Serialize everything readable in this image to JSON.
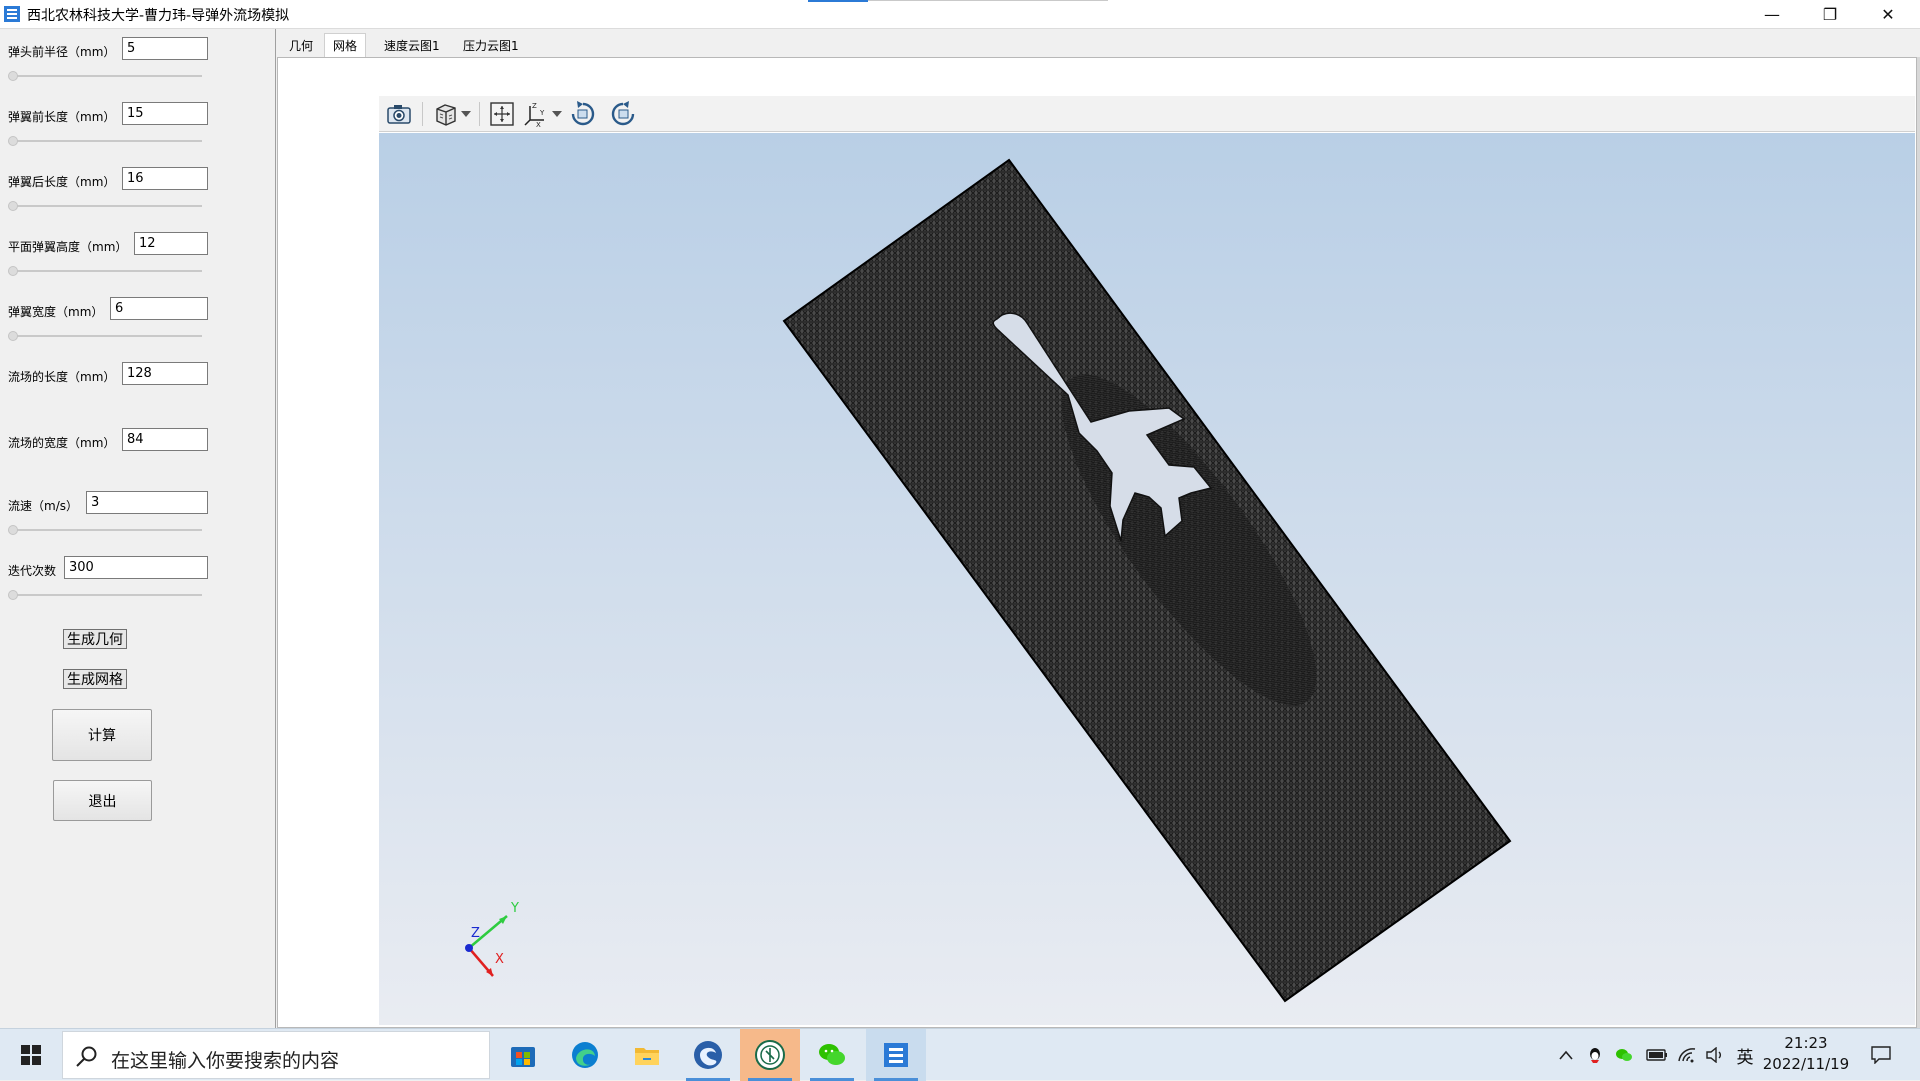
{
  "window": {
    "title": "西北农林科技大学-曹力玮-导弹外流场模拟",
    "minimize_glyph": "—",
    "restore_glyph": "❐",
    "close_glyph": "✕"
  },
  "params": [
    {
      "label": "弹头前半径（mm）",
      "value": "5"
    },
    {
      "label": "弹翼前长度（mm）",
      "value": "15"
    },
    {
      "label": "弹翼后长度（mm）",
      "value": "16"
    },
    {
      "label": "平面弹翼高度（mm）",
      "value": "12"
    },
    {
      "label": "弹翼宽度（mm）",
      "value": "6"
    },
    {
      "label": "流场的长度（mm）",
      "value": "128"
    },
    {
      "label": "流场的宽度（mm）",
      "value": "84"
    },
    {
      "label": "流速（m/s）",
      "value": "3"
    },
    {
      "label": "迭代次数",
      "value": "300"
    }
  ],
  "buttons": {
    "gen_geometry": "生成几何",
    "gen_mesh": "生成网格",
    "compute": "计算",
    "exit": "退出"
  },
  "tabs": [
    {
      "label": "几何"
    },
    {
      "label": "网格"
    },
    {
      "label": "速度云图1"
    },
    {
      "label": "压力云图1"
    }
  ],
  "active_tab": "网格",
  "toolbar_icons": [
    "camera-icon",
    "view-cube-icon",
    "reset-camera-icon",
    "axes-orientation-icon",
    "rotate-cw-icon",
    "rotate-ccw-icon"
  ],
  "axes_labels": {
    "x": "X",
    "y": "Y",
    "z": "Z"
  },
  "taskbar": {
    "search_placeholder": "在这里输入你要搜索的内容",
    "apps": [
      "store-icon",
      "edge-icon",
      "file-explorer-icon",
      "app-swirl-icon",
      "university-app-icon",
      "wechat-icon",
      "mesh-app-icon"
    ],
    "ime": "英",
    "time": "21:23",
    "date": "2022/11/19"
  },
  "colors": {
    "accent": "#2b7ad6",
    "viewport_top": "#b9cfe6",
    "viewport_bottom": "#e9ecf2",
    "mesh": "#1a1a1a"
  }
}
